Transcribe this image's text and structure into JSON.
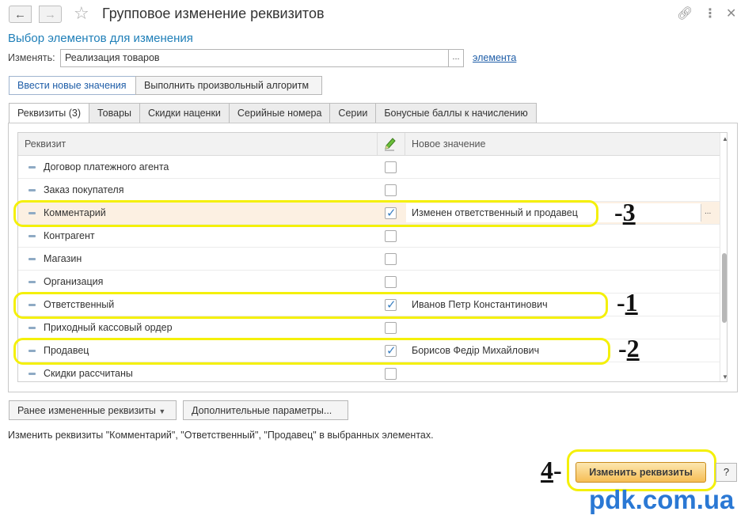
{
  "window": {
    "title": "Групповое изменение реквизитов",
    "subtitle": "Выбор элементов для изменения"
  },
  "icons": {
    "back": "arrow-left-icon",
    "forward": "arrow-right-icon",
    "favorite": "star-icon",
    "link": "link-icon",
    "more": "more-vertical-icon",
    "close": "close-icon"
  },
  "change_field": {
    "label": "Изменять:",
    "value": "Реализация товаров",
    "select_button": "...",
    "link": "элемента"
  },
  "mode_buttons": [
    "Ввести новые значения",
    "Выполнить произвольный алгоритм"
  ],
  "tabs": [
    "Реквизиты (3)",
    "Товары",
    "Скидки наценки",
    "Серийные номера",
    "Серии",
    "Бонусные баллы к начислению"
  ],
  "table": {
    "columns": {
      "attribute": "Реквизит",
      "new_value": "Новое значение"
    },
    "rows": [
      {
        "name": "Договор платежного агента",
        "checked": false,
        "value": ""
      },
      {
        "name": "Заказ покупателя",
        "checked": false,
        "value": ""
      },
      {
        "name": "Комментарий",
        "checked": true,
        "value": "Изменен ответственный и продавец",
        "selected": true
      },
      {
        "name": "Контрагент",
        "checked": false,
        "value": ""
      },
      {
        "name": "Магазин",
        "checked": false,
        "value": ""
      },
      {
        "name": "Организация",
        "checked": false,
        "value": ""
      },
      {
        "name": "Ответственный",
        "checked": true,
        "value": "Иванов  Петр  Константинович"
      },
      {
        "name": "Приходный кассовый ордер",
        "checked": false,
        "value": ""
      },
      {
        "name": "Продавец",
        "checked": true,
        "value": "Борисов Федір Михайлович"
      },
      {
        "name": "Скидки рассчитаны",
        "checked": false,
        "value": ""
      }
    ],
    "value_dots": "..."
  },
  "annotations": {
    "n1_dash": "-",
    "n1_num": "1",
    "n2_dash": "-",
    "n2_num": "2",
    "n3_dash": "-",
    "n3_num": "3",
    "n4_num": "4",
    "n4_dash": "-"
  },
  "bottom_buttons": {
    "previous": "Ранее измененные реквизиты",
    "additional": "Дополнительные параметры..."
  },
  "info_text": "Изменить реквизиты \"Комментарий\", \"Ответственный\", \"Продавец\" в выбранных элементах.",
  "apply_button": "Изменить реквизиты",
  "help_button": "?",
  "watermark": "pdk.com.ua",
  "colors": {
    "accent": "#1f7fb8",
    "highlight_row": "#fcf0e2",
    "annotation_yellow": "#f4f00a",
    "apply_button": "#f6be55",
    "watermark": "#2a78d4"
  }
}
